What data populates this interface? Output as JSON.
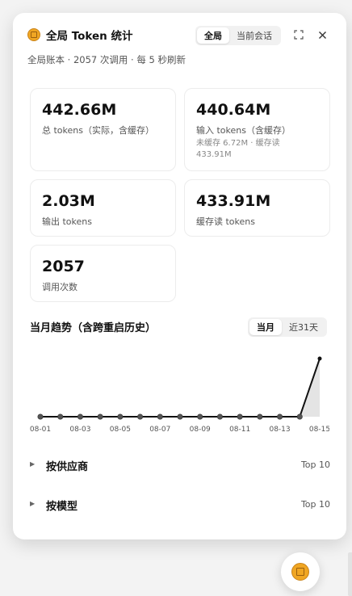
{
  "header": {
    "title": "全局 Token 统计",
    "scope_tabs": [
      {
        "label": "全局",
        "active": true
      },
      {
        "label": "当前会话",
        "active": false
      }
    ],
    "icons": [
      "expand-icon",
      "close-icon"
    ]
  },
  "subtitle": "全局账本 · 2057 次调用 · 每 5 秒刷新",
  "stats": {
    "total": {
      "value": "442.66M",
      "label": "总 tokens（实际，含缓存）"
    },
    "input": {
      "value": "440.64M",
      "label": "输入 tokens（含缓存）",
      "detail": "未缓存 6.72M · 缓存读 433.91M"
    },
    "output": {
      "value": "2.03M",
      "label": "输出 tokens"
    },
    "cache_read": {
      "value": "433.91M",
      "label": "缓存读 tokens"
    },
    "calls": {
      "value": "2057",
      "label": "调用次数"
    }
  },
  "trend": {
    "title": "当月趋势（含跨重启历史）",
    "tabs": [
      {
        "label": "当月",
        "active": true
      },
      {
        "label": "近31天",
        "active": false
      }
    ]
  },
  "chart_data": {
    "type": "area",
    "x": [
      "08-01",
      "08-02",
      "08-03",
      "08-04",
      "08-05",
      "08-06",
      "08-07",
      "08-08",
      "08-09",
      "08-10",
      "08-11",
      "08-12",
      "08-13",
      "08-14",
      "08-15"
    ],
    "y": [
      0,
      0,
      0,
      0,
      0,
      0,
      0,
      0,
      0,
      0,
      0,
      0,
      0,
      0,
      442.66
    ],
    "tick_labels": [
      "08-01",
      "08-03",
      "08-05",
      "08-07",
      "08-09",
      "08-11",
      "08-13",
      "08-15"
    ],
    "title": "",
    "xlabel": "",
    "ylabel": "",
    "grid": false,
    "colors": {
      "line": "#111111",
      "fill": "#e4e4e4",
      "point": "#555555"
    }
  },
  "groups": [
    {
      "label": "按供应商",
      "top": "Top 10"
    },
    {
      "label": "按模型",
      "top": "Top 10"
    }
  ],
  "colors": {
    "accent": "#f0a623",
    "text": "#111111",
    "muted": "#555555"
  }
}
